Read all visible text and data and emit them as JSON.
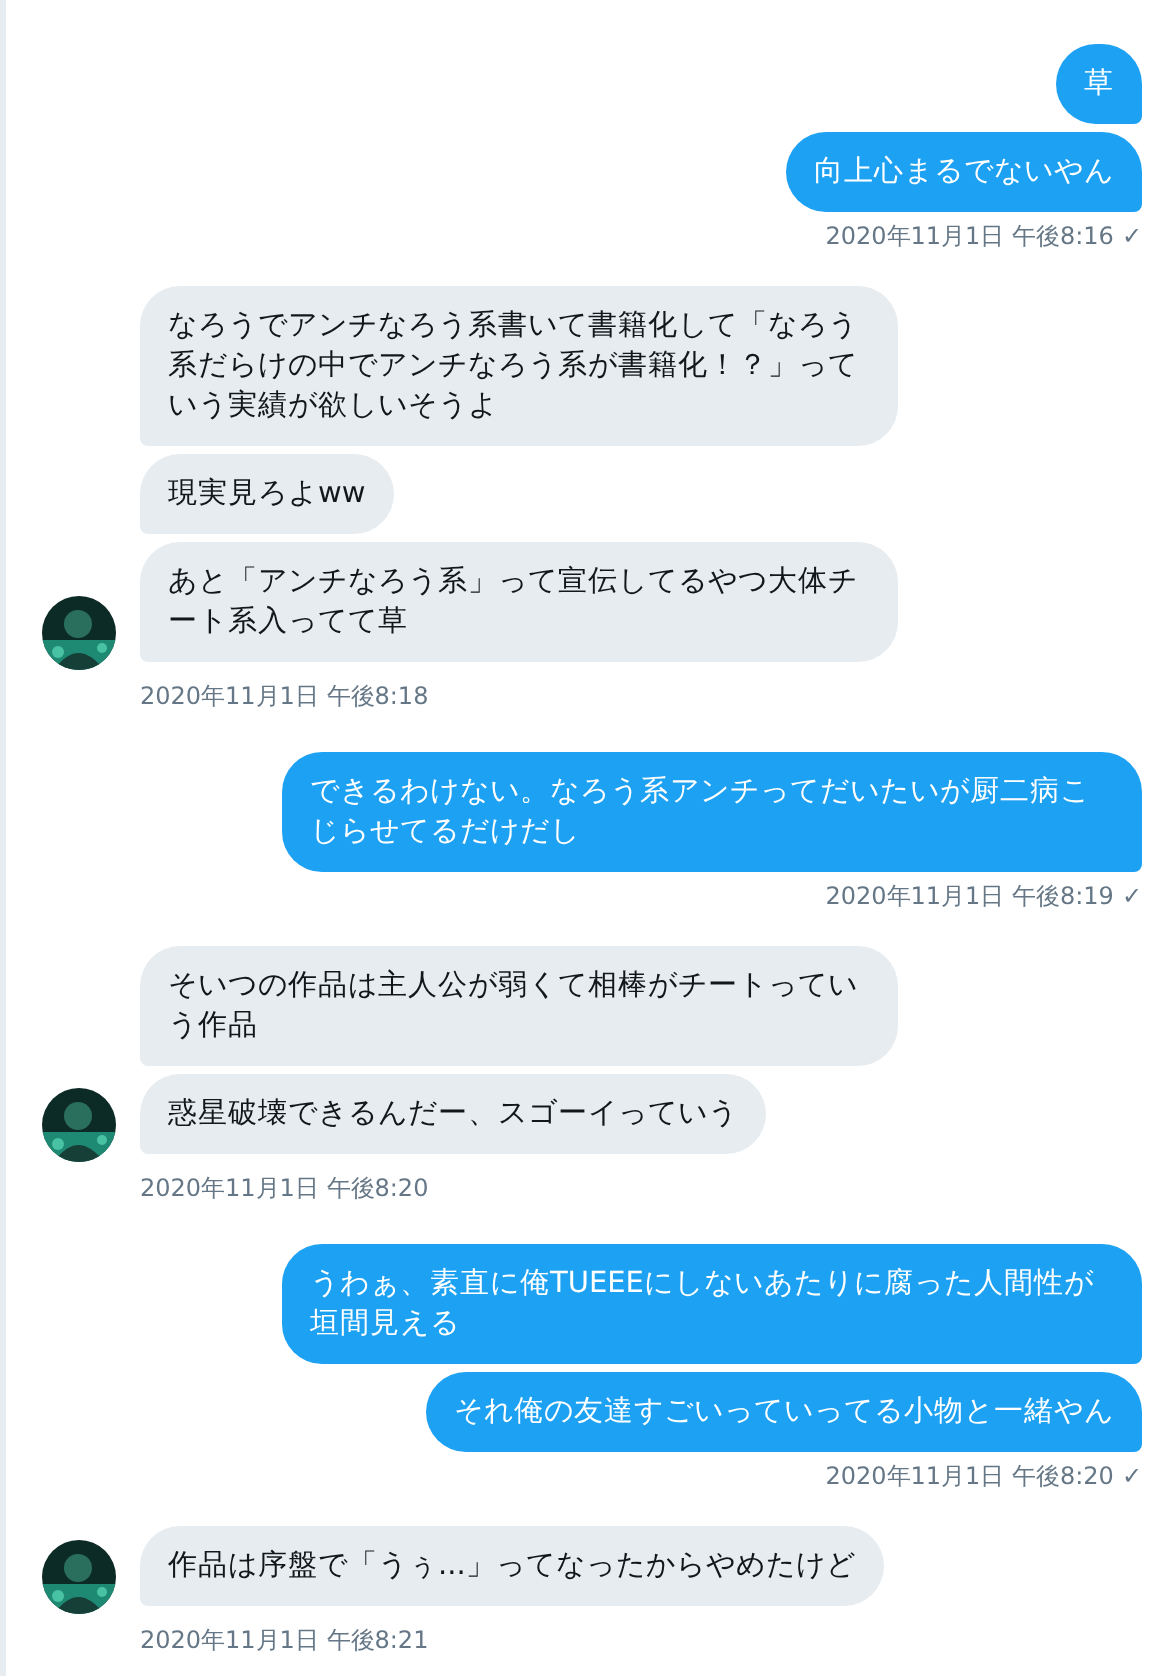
{
  "conversation": [
    {
      "kind": "sent",
      "messages": [
        "草",
        "向上心まるでないやん"
      ],
      "time": "2020年11月1日 午後8:16",
      "receipt": "✓"
    },
    {
      "kind": "received",
      "messages": [
        "なろうでアンチなろう系書いて書籍化して「なろう系だらけの中でアンチなろう系が書籍化！？」っていう実績が欲しいそうよ",
        "現実見ろよww",
        "あと「アンチなろう系」って宣伝してるやつ大体チート系入ってて草"
      ],
      "time": "2020年11月1日 午後8:18"
    },
    {
      "kind": "sent",
      "messages": [
        "できるわけない。なろう系アンチってだいたいが厨二病こじらせてるだけだし"
      ],
      "time": "2020年11月1日 午後8:19",
      "receipt": "✓"
    },
    {
      "kind": "received",
      "messages": [
        "そいつの作品は主人公が弱くて相棒がチートっていう作品",
        "惑星破壊できるんだー、スゴーイっていう"
      ],
      "time": "2020年11月1日 午後8:20"
    },
    {
      "kind": "sent",
      "messages": [
        "うわぁ、素直に俺TUEEEにしないあたりに腐った人間性が垣間見える",
        "それ俺の友達すごいっていってる小物と一緒やん"
      ],
      "time": "2020年11月1日 午後8:20",
      "receipt": "✓"
    },
    {
      "kind": "received",
      "messages": [
        "作品は序盤で「うぅ...」ってなったからやめたけど"
      ],
      "time": "2020年11月1日 午後8:21"
    }
  ]
}
